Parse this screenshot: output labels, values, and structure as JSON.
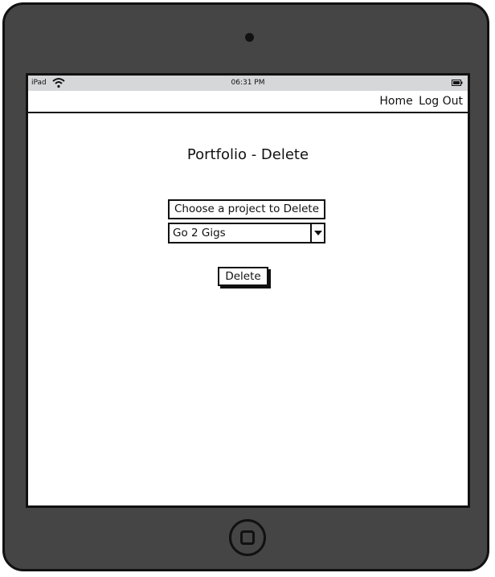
{
  "status_bar": {
    "device": "iPad",
    "time": "06:31 PM",
    "wifi_icon": "wifi-icon",
    "battery_icon": "battery-icon"
  },
  "nav": {
    "home": "Home",
    "logout": "Log Out"
  },
  "page": {
    "title": "Portfolio - Delete",
    "choose_label": "Choose a project to Delete",
    "select_value": "Go 2 Gigs",
    "delete_label": "Delete"
  },
  "colors": {
    "device_body": "#454545",
    "status_bar": "#d5d7d9",
    "outline": "#111111"
  }
}
